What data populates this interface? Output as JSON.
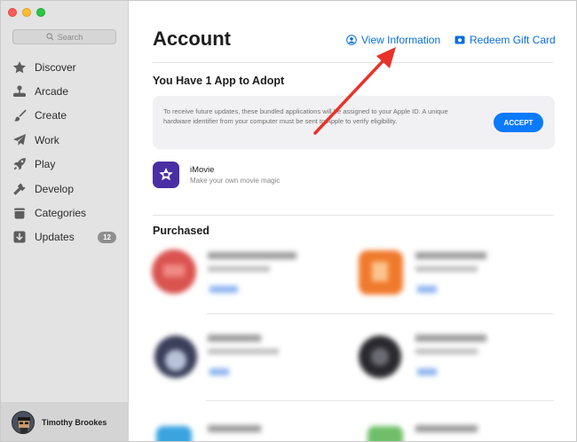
{
  "window": {
    "traffic_lights": [
      "close",
      "minimize",
      "zoom"
    ]
  },
  "sidebar": {
    "search_placeholder": "Search",
    "items": [
      {
        "label": "Discover",
        "icon": "star-icon"
      },
      {
        "label": "Arcade",
        "icon": "joystick-icon"
      },
      {
        "label": "Create",
        "icon": "brush-icon"
      },
      {
        "label": "Work",
        "icon": "paper-plane-icon"
      },
      {
        "label": "Play",
        "icon": "rocket-icon"
      },
      {
        "label": "Develop",
        "icon": "hammer-icon"
      },
      {
        "label": "Categories",
        "icon": "box-icon"
      },
      {
        "label": "Updates",
        "icon": "download-icon",
        "badge": "12"
      }
    ],
    "user_name": "Timothy Brookes"
  },
  "header": {
    "title": "Account",
    "view_info_label": "View Information",
    "redeem_label": "Redeem Gift Card"
  },
  "adopt": {
    "heading": "You Have 1 App to Adopt",
    "notice": "To receive future updates, these bundled applications will be assigned to your Apple ID. A unique hardware identifier from your computer must be sent to Apple to verify eligibility.",
    "accept_label": "ACCEPT",
    "app_name": "iMovie",
    "app_subtitle": "Make your own movie magic"
  },
  "purchased": {
    "heading": "Purchased"
  },
  "colors": {
    "accent": "#0a7aff",
    "link": "#0a6ee0",
    "annotation_arrow": "#e8332a"
  }
}
